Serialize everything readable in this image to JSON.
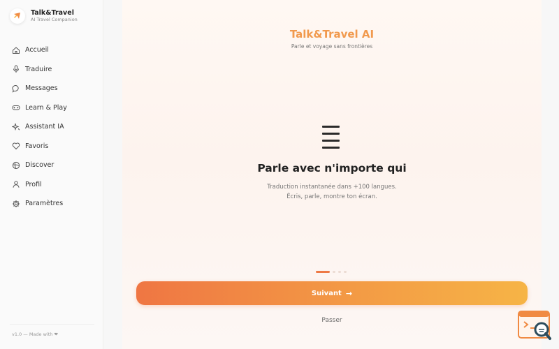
{
  "sidebar": {
    "brand_title": "Talk&Travel",
    "brand_subtitle": "AI Travel Companion",
    "items": [
      {
        "label": "Accueil",
        "icon": "home-icon"
      },
      {
        "label": "Traduire",
        "icon": "microphone-icon"
      },
      {
        "label": "Messages",
        "icon": "chat-bubble-icon"
      },
      {
        "label": "Learn & Play",
        "icon": "gamepad-icon"
      },
      {
        "label": "Assistant IA",
        "icon": "sparkles-icon"
      },
      {
        "label": "Favoris",
        "icon": "heart-icon"
      },
      {
        "label": "Discover",
        "icon": "globe-icon"
      },
      {
        "label": "Profil",
        "icon": "user-icon"
      },
      {
        "label": "Paramètres",
        "icon": "gear-icon"
      }
    ],
    "footer": "v1.0 — Made with ❤"
  },
  "onboarding": {
    "app_title": "Talk&Travel AI",
    "app_subtitle": "Parle et voyage sans frontières",
    "slide_title": "Parle avec n'importe qui",
    "slide_desc_line1": "Traduction instantanée dans +100 langues.",
    "slide_desc_line2": "Écris, parle, montre ton écran.",
    "dots_total": 4,
    "dots_active": 1,
    "next_label": "Suivant",
    "skip_label": "Passer"
  },
  "colors": {
    "accent": "#ee7a45",
    "accent_end": "#f6b446",
    "title": "#f19a4e"
  }
}
